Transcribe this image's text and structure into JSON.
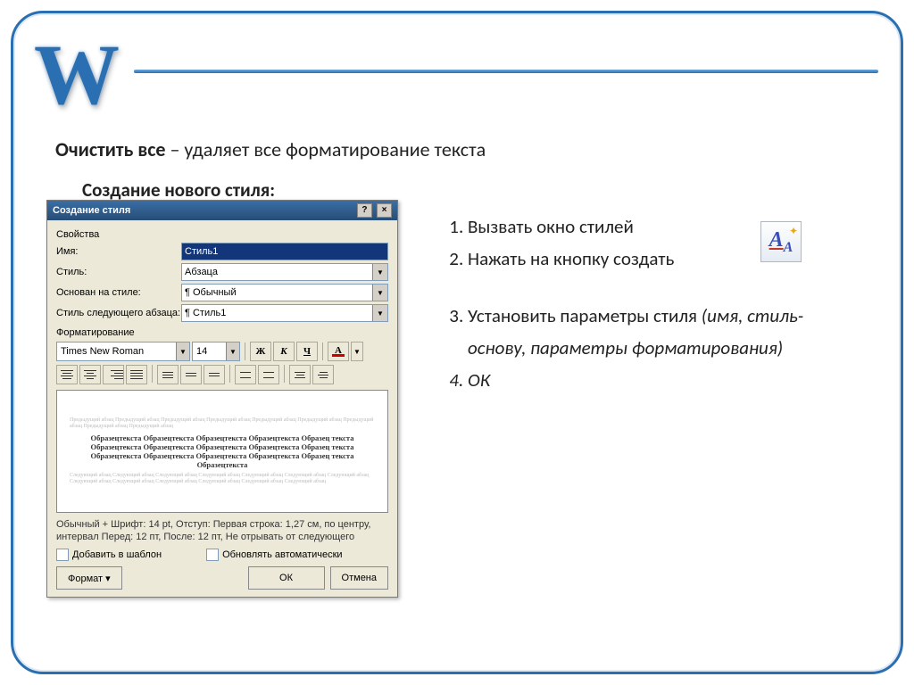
{
  "header": {
    "logo_letter": "W"
  },
  "title": {
    "bold": "Очистить все",
    "rest": " – удаляет все форматирование текста"
  },
  "subtitle": "Создание нового стиля:",
  "dialog": {
    "title": "Создание стиля",
    "help_btn": "?",
    "close_btn": "×",
    "section_props": "Свойства",
    "name_label": "Имя:",
    "name_value": "Стиль1",
    "style_label": "Стиль:",
    "style_value": "Абзаца",
    "based_label": "Основан на стиле:",
    "based_value": "¶ Обычный",
    "next_label": "Стиль следующего абзаца:",
    "next_value": "¶ Стиль1",
    "section_format": "Форматирование",
    "font_value": "Times New Roman",
    "size_value": "14",
    "btn_bold": "Ж",
    "btn_italic": "К",
    "btn_underline": "Ч",
    "btn_color": "A",
    "preview_faint1": "Предыдущий абзац Предыдущий абзац Предыдущий абзац Предыдущий абзац Предыдущий абзац Предыдущий абзац Предыдущий абзац Предыдущий абзац Предыдущий абзац",
    "preview_sample": "Образецтекста Образецтекста Образецтекста Образецтекста Образец текста Образецтекста Образецтекста Образецтекста Образецтекста Образец текста Образецтекста Образецтекста Образецтекста Образецтекста Образец текста Образецтекста",
    "preview_faint2": "Следующий абзац Следующий абзац Следующий абзац Следующий абзац Следующий абзац Следующий абзац Следующий абзац Следующий абзац Следующий абзац Следующий абзац Следующий абзац Следующий абзац Следующий абзац",
    "description": "Обычный + Шрифт: 14 pt, Отступ: Первая строка: 1,27 см, по центру, интервал Перед: 12 пт, После: 12 пт, Не отрывать от следующего",
    "check_template": "Добавить в шаблон",
    "check_auto": "Обновлять автоматически",
    "btn_format": "Формат ▾",
    "btn_ok": "ОК",
    "btn_cancel": "Отмена"
  },
  "steps": {
    "s1": "Вызвать окно стилей",
    "s2": "Нажать на кнопку создать",
    "s3a": "Установить параметры стиля ",
    "s3b": "(имя, стиль-основу, параметры форматирования)",
    "s4": "ОК"
  },
  "icon": {
    "aa": "A",
    "spark": "✦"
  }
}
